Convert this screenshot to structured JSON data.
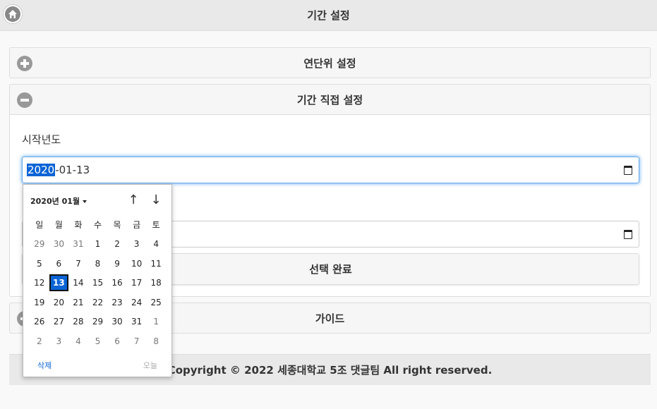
{
  "header": {
    "title": "기간 설정",
    "home_icon": "home-icon"
  },
  "sections": {
    "yearly": {
      "title": "연단위 설정"
    },
    "period": {
      "title": "기간 직접 설정",
      "start_label": "시작년도",
      "start_value_year": "2020",
      "start_value_rest": "-01-13",
      "done_label": "선택 완료"
    },
    "guide": {
      "title": "가이드"
    }
  },
  "footer": {
    "text": "Copyright © 2022 세종대학교 5조 댓글팀 All right reserved."
  },
  "calendar": {
    "month_label": "2020년 01월",
    "up_label": "↑",
    "down_label": "↓",
    "weekdays": [
      "일",
      "월",
      "화",
      "수",
      "목",
      "금",
      "토"
    ],
    "weeks": [
      [
        "29",
        "30",
        "31",
        "1",
        "2",
        "3",
        "4"
      ],
      [
        "5",
        "6",
        "7",
        "8",
        "9",
        "10",
        "11"
      ],
      [
        "12",
        "13",
        "14",
        "15",
        "16",
        "17",
        "18"
      ],
      [
        "19",
        "20",
        "21",
        "22",
        "23",
        "24",
        "25"
      ],
      [
        "26",
        "27",
        "28",
        "29",
        "30",
        "31",
        "1"
      ],
      [
        "2",
        "3",
        "4",
        "5",
        "6",
        "7",
        "8"
      ]
    ],
    "selected_day": "13",
    "clear_label": "삭제",
    "today_label": "오늘",
    "accent_color": "#0a64d6"
  }
}
